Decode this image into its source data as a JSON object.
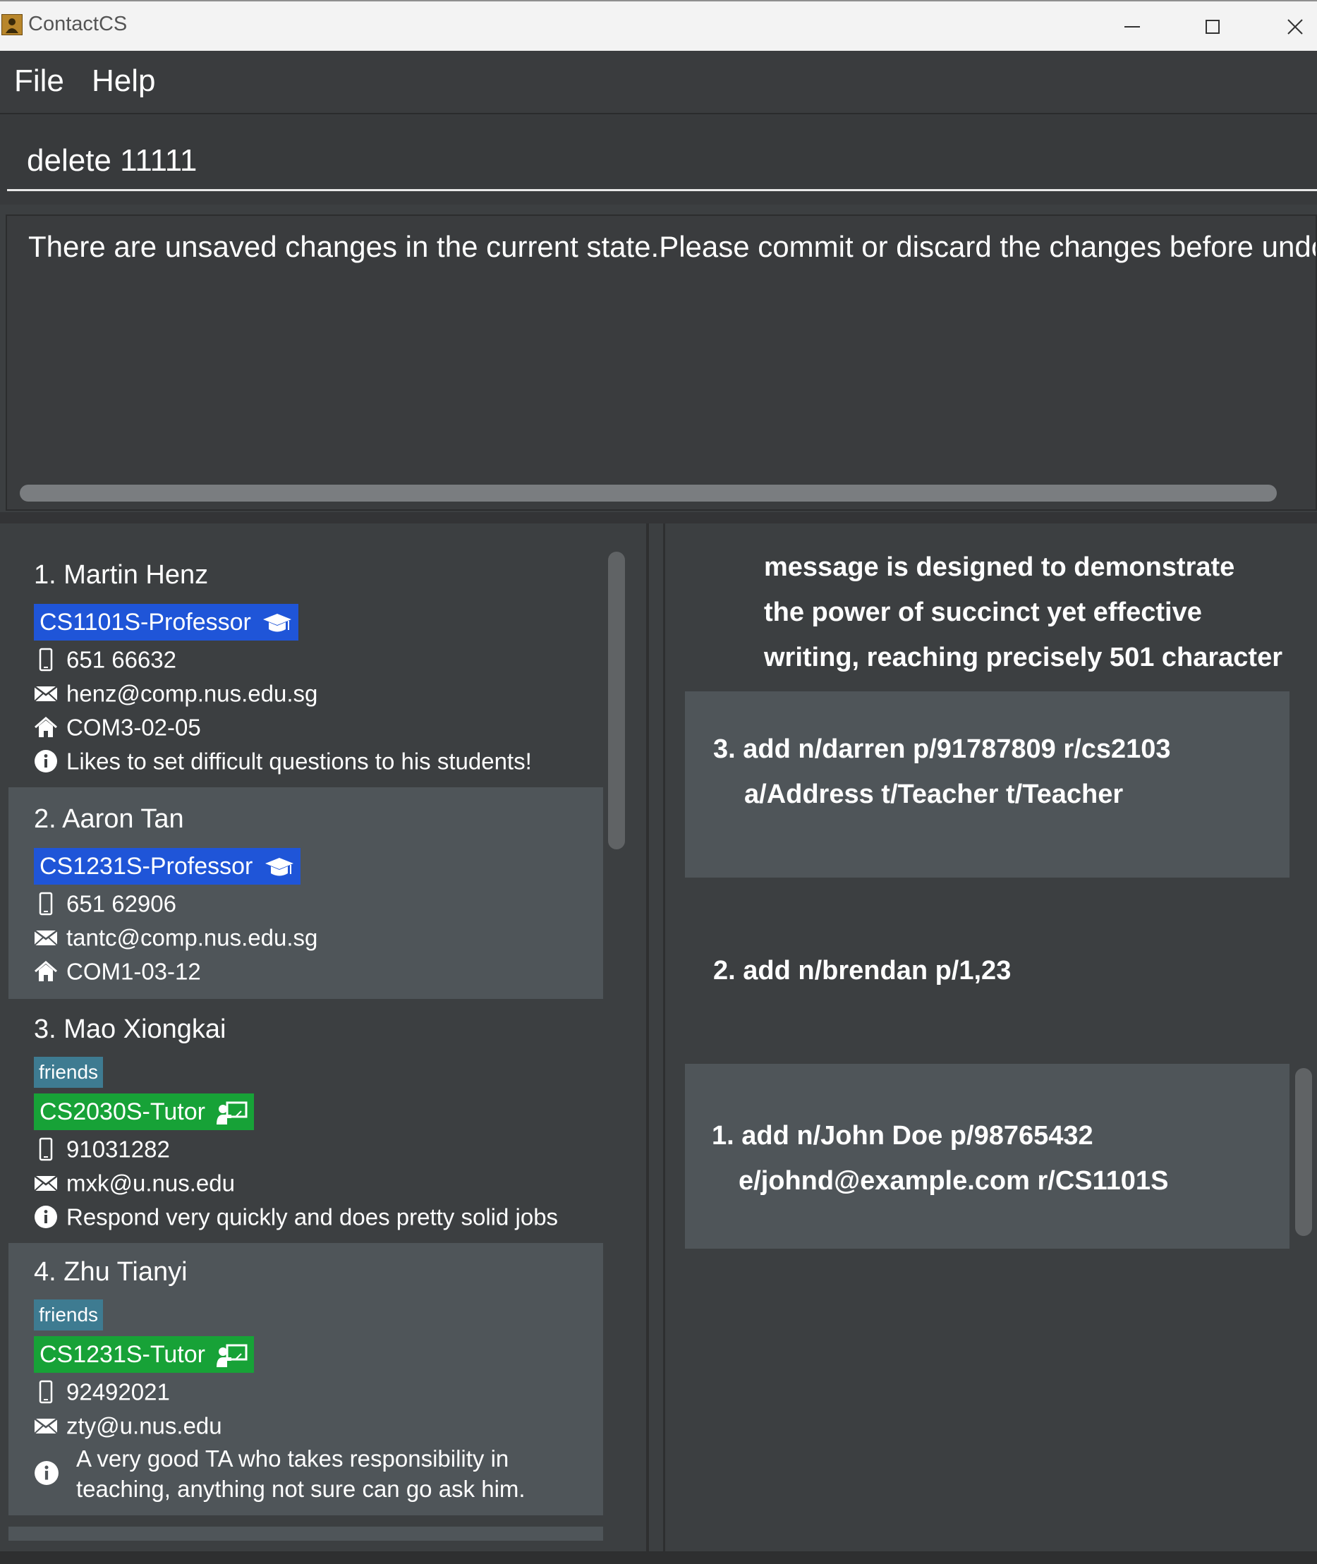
{
  "window": {
    "title": "ContactCS",
    "icons": [
      "app-icon",
      "minimize-icon",
      "maximize-icon",
      "close-icon"
    ]
  },
  "menu": {
    "file": "File",
    "help": "Help"
  },
  "command": {
    "value": "delete 11111"
  },
  "result": {
    "text": "There are unsaved changes in the current state.Please commit or discard the changes before undoing"
  },
  "persons": [
    {
      "name": "1. Martin Henz",
      "tags": [],
      "role": "CS1101S-Professor",
      "role_icon": "graduation-cap-icon",
      "phone": "651 66632",
      "email": "henz@comp.nus.edu.sg",
      "address": "COM3-02-05",
      "remark": "Likes to set difficult questions to his students!"
    },
    {
      "name": "2. Aaron Tan",
      "tags": [],
      "role": "CS1231S-Professor",
      "role_icon": "graduation-cap-icon",
      "phone": "651 62906",
      "email": "tantc@comp.nus.edu.sg",
      "address": "COM1-03-12"
    },
    {
      "name": "3. Mao Xiongkai",
      "tags": [
        "friends"
      ],
      "role": "CS2030S-Tutor",
      "role_icon": "tutor-board-icon",
      "phone": "91031282",
      "email": "mxk@u.nus.edu",
      "remark": "Respond very quickly and does pretty solid jobs"
    },
    {
      "name": "4. Zhu Tianyi",
      "tags": [
        "friends"
      ],
      "role": "CS1231S-Tutor",
      "role_icon": "tutor-board-icon",
      "phone": "92492021",
      "email": "zty@u.nus.edu",
      "remark_lines": [
        "A very good TA who takes responsibility in",
        "teaching, anything not sure can go ask him."
      ]
    }
  ],
  "history": [
    {
      "lines": [
        "message is designed to demonstrate",
        "the power of succinct yet effective",
        "writing, reaching precisely 501 character"
      ]
    },
    {
      "lines": [
        "3. add n/darren p/91787809 r/cs2103",
        "a/Address t/Teacher t/Teacher"
      ]
    },
    {
      "lines": [
        "2. add n/brendan p/1,23"
      ]
    },
    {
      "lines": [
        "1. add n/John Doe p/98765432",
        "e/johnd@example.com r/CS1101S"
      ]
    }
  ],
  "colors": {
    "background": "#3c3f41",
    "card_alt": "#4f5559",
    "professor_tag": "#1f55d8",
    "tutor_tag": "#17a237",
    "friend_tag": "#3e7b91"
  }
}
